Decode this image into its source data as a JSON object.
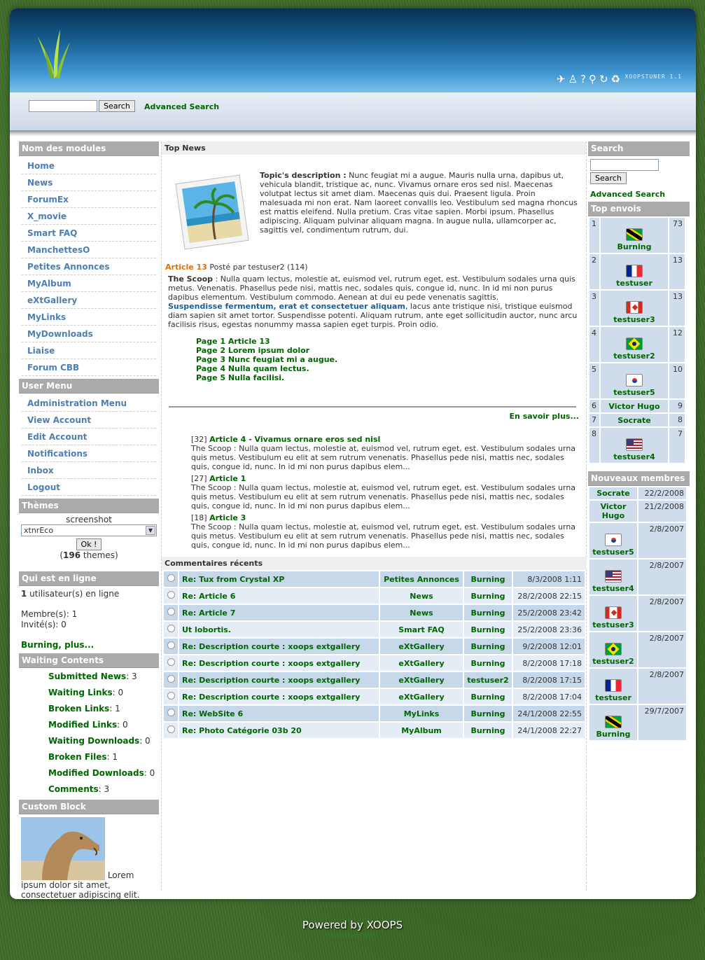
{
  "header": {
    "brand": "XOOPSTUNER 1.1",
    "tool_icons": [
      "plane-icon",
      "person-icon",
      "help-icon",
      "walk-icon",
      "refresh-icon",
      "recycle-icon"
    ]
  },
  "top_search": {
    "button": "Search",
    "advanced": "Advanced Search",
    "value": ""
  },
  "left": {
    "modules_title": "Nom des modules",
    "modules": [
      "Home",
      "News",
      "ForumEx",
      "X_movie",
      "Smart FAQ",
      "ManchettesO",
      "Petites Annonces",
      "MyAlbum",
      "eXtGallery",
      "MyLinks",
      "MyDownloads",
      "Liaise",
      "Forum CBB"
    ],
    "user_menu_title": "User Menu",
    "user_menu": [
      "Administration Menu",
      "View Account",
      "Edit Account",
      "Notifications",
      "Inbox",
      "Logout"
    ],
    "themes_title": "Thèmes",
    "themes_screenshot": "screenshot",
    "themes_selected": "xtnrEco",
    "themes_ok": "Ok !",
    "themes_count": "196",
    "themes_suffix": " themes)",
    "themes_prefix": "(",
    "online_title": "Qui est en ligne",
    "online_count": "1",
    "online_text": " utilisateur(s) en ligne",
    "online_members": "Membre(s): 1",
    "online_guests": "Invité(s): 0",
    "online_user": "Burning",
    "online_more": ", plus...",
    "waiting_title": "Waiting Contents",
    "waiting": [
      {
        "label": "Submitted News",
        "value": ": 3"
      },
      {
        "label": "Waiting Links",
        "value": ": 0"
      },
      {
        "label": "Broken Links",
        "value": ": 1"
      },
      {
        "label": "Modified Links",
        "value": ": 0"
      },
      {
        "label": "Waiting Downloads",
        "value": ": 0"
      },
      {
        "label": "Broken Files",
        "value": ": 1"
      },
      {
        "label": "Modified Downloads",
        "value": ": 0"
      },
      {
        "label": "Comments",
        "value": ": 3"
      }
    ],
    "custom_title": "Custom Block",
    "custom_text": "Lorem ipsum dolor sit amet, consectetuer adipiscing elit."
  },
  "center": {
    "top_news_title": "Top News",
    "topic_label": "Topic's description :",
    "topic_text": " Nunc feugiat mi a augue. Mauris nulla urna, dapibus ut, vehicula blandit, tristique ac, nunc. Vivamus ornare eros sed nisl. Maecenas volutpat lectus sit amet diam. Maecenas quis dui. Praesent ligula. Proin malesuada mi non erat. Nam laoreet convallis leo. Vestibulum sed magna rhoncus est mattis eleifend. Nulla pretium. Cras vitae sapien. Morbi ipsum. Phasellus adipiscing. Aliquam pulvinar aliquam magna. In augue nulla, ullamcorper ac, sagittis vel, condimentum rutrum, dui.",
    "article_title": "Article 13",
    "article_meta": " Posté par testuser2 (114)",
    "scoop_label": "The Scoop",
    "scoop_text": " : Nulla quam lectus, molestie at, euismod vel, rutrum eget, est. Vestibulum sodales urna quis metus. Venenatis. Phasellus pede nisi, mattis nec, sodales quis, congue id, nunc. In id mi non purus dapibus elementum. Vestibulum commodo. Aenean at dui eu pede venenatis sagittis.",
    "scoop_link": "Suspendisse fermentum, erat et consectetuer aliquam",
    "scoop_text2": ", lacus ante tristique nisi, tristique euismod diam sapien sit amet tortor. Suspendisse potenti. Aliquam rutrum, ante eget sollicitudin auctor, nunc arcu facilisis risus, egestas nonummy massa sapien eget turpis. Proin odio.",
    "pages": [
      "Page 1 Article 13",
      "Page 2 Lorem ipsum dolor",
      "Page 3 Nunc feugiat mi a augue.",
      "Page 4 Nulla quam lectus.",
      "Page 5 Nulla facilisi."
    ],
    "more": "En savoir plus...",
    "others": [
      {
        "num": "[32]",
        "title": "Article 4 - Vivamus ornare eros sed nisl",
        "text": "The Scoop : Nulla quam lectus, molestie at, euismod vel, rutrum eget, est. Vestibulum sodales urna quis metus. Vestibulum eu elit at sem rutrum venenatis. Phasellus pede nisi, mattis nec, sodales quis, congue id, nunc. In id mi non purus dapibus elem..."
      },
      {
        "num": "[27]",
        "title": "Article 1",
        "text": "The Scoop : Nulla quam lectus, molestie at, euismod vel, rutrum eget, est. Vestibulum sodales urna quis metus. Vestibulum eu elit at sem rutrum venenatis. Phasellus pede nisi, mattis nec, sodales quis, congue id, nunc. In id mi non purus dapibus elem..."
      },
      {
        "num": "[18]",
        "title": "Article 3",
        "text": "The Scoop : Nulla quam lectus, molestie at, euismod vel, rutrum eget, est. Vestibulum sodales urna quis metus. Vestibulum eu elit at sem rutrum venenatis. Phasellus pede nisi, mattis nec, sodales quis, congue id, nunc. In id mi non purus dapibus elem..."
      }
    ],
    "comments_title": "Commentaires récents",
    "comments": [
      {
        "title": "Re: Tux from Crystal XP",
        "module": "Petites Annonces",
        "user": "Burning",
        "date": "8/3/2008 1:11"
      },
      {
        "title": "Re: Article 6",
        "module": "News",
        "user": "Burning",
        "date": "28/2/2008 22:15"
      },
      {
        "title": "Re: Article 7",
        "module": "News",
        "user": "Burning",
        "date": "25/2/2008 23:42"
      },
      {
        "title": "Ut lobortis.",
        "module": "Smart FAQ",
        "user": "Burning",
        "date": "25/2/2008 23:36"
      },
      {
        "title": "Re: Description courte : xoops extgallery",
        "module": "eXtGallery",
        "user": "Burning",
        "date": "9/2/2008 12:01"
      },
      {
        "title": "Re: Description courte : xoops extgallery",
        "module": "eXtGallery",
        "user": "Burning",
        "date": "8/2/2008 17:18"
      },
      {
        "title": "Re: Description courte : xoops extgallery",
        "module": "eXtGallery",
        "user": "testuser2",
        "date": "8/2/2008 17:15"
      },
      {
        "title": "Re: Description courte : xoops extgallery",
        "module": "eXtGallery",
        "user": "Burning",
        "date": "8/2/2008 17:04"
      },
      {
        "title": "Re: WebSite 6",
        "module": "MyLinks",
        "user": "Burning",
        "date": "24/1/2008 22:55"
      },
      {
        "title": "Re: Photo Catégorie 03b 20",
        "module": "MyAlbum",
        "user": "Burning",
        "date": "24/1/2008 22:27"
      }
    ]
  },
  "right": {
    "search_title": "Search",
    "search_button": "Search",
    "advanced": "Advanced Search",
    "top_title": "Top envois",
    "top": [
      {
        "rank": "1",
        "user": "Burning",
        "flag": "jm",
        "count": "73"
      },
      {
        "rank": "2",
        "user": "testuser",
        "flag": "fr",
        "count": "13"
      },
      {
        "rank": "3",
        "user": "testuser3",
        "flag": "ca",
        "count": "13"
      },
      {
        "rank": "4",
        "user": "testuser2",
        "flag": "br",
        "count": "12"
      },
      {
        "rank": "5",
        "user": "testuser5",
        "flag": "kr",
        "count": "10"
      },
      {
        "rank": "6",
        "user": "Victor Hugo",
        "flag": "",
        "count": "9"
      },
      {
        "rank": "7",
        "user": "Socrate",
        "flag": "",
        "count": "8"
      },
      {
        "rank": "8",
        "user": "testuser4",
        "flag": "us",
        "count": "7"
      }
    ],
    "new_title": "Nouveaux membres",
    "new": [
      {
        "user": "Socrate",
        "flag": "",
        "date": "22/2/2008"
      },
      {
        "user": "Victor Hugo",
        "flag": "",
        "date": "21/2/2008"
      },
      {
        "user": "testuser5",
        "flag": "kr",
        "date": "2/8/2007"
      },
      {
        "user": "testuser4",
        "flag": "us",
        "date": "2/8/2007"
      },
      {
        "user": "testuser3",
        "flag": "ca",
        "date": "2/8/2007"
      },
      {
        "user": "testuser2",
        "flag": "br",
        "date": "2/8/2007"
      },
      {
        "user": "testuser",
        "flag": "fr",
        "date": "2/8/2007"
      },
      {
        "user": "Burning",
        "flag": "jm",
        "date": "29/7/2007"
      }
    ]
  },
  "footer": {
    "powered": "Powered by XOOPS",
    "sub": "XoopsTuner.com"
  }
}
